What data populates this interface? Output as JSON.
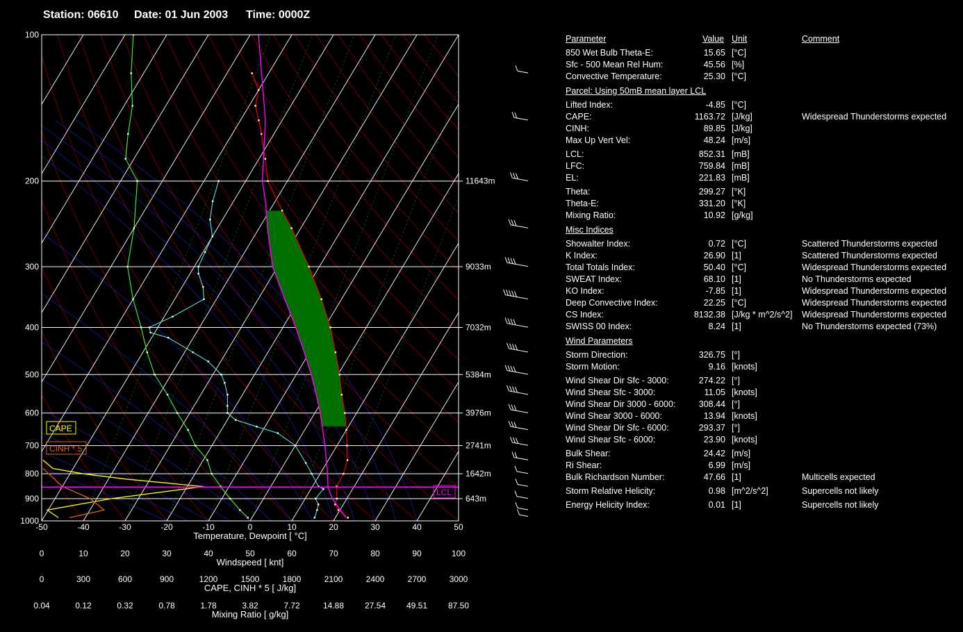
{
  "header": {
    "station": "Station: 06610",
    "date": "Date: 01 Jun 2003",
    "time": "Time: 0000Z"
  },
  "colors": {
    "background": "#000000",
    "temperature": "#ff0000",
    "dewpoint": "#55e0e0",
    "parcel": "#ff00ff",
    "mixing_ratio": "#33ff33",
    "cape_fill": "#007000",
    "cape_label": "#ffff00",
    "cinh_label": "#d9602a",
    "lcl": "#ff00ff"
  },
  "chart_data": {
    "type": "line",
    "title": "",
    "pressure_ticks": [
      "100",
      "200",
      "300",
      "400",
      "500",
      "600",
      "700",
      "800",
      "900",
      "1000"
    ],
    "pressure_values": [
      100,
      200,
      300,
      400,
      500,
      600,
      700,
      800,
      900,
      1000
    ],
    "height_labels": [
      {
        "p": 200,
        "label": "11643m"
      },
      {
        "p": 300,
        "label": "9033m"
      },
      {
        "p": 400,
        "label": "7032m"
      },
      {
        "p": 500,
        "label": "5384m"
      },
      {
        "p": 600,
        "label": "3976m"
      },
      {
        "p": 700,
        "label": "2741m"
      },
      {
        "p": 800,
        "label": "1642m"
      },
      {
        "p": 900,
        "label": "643m"
      }
    ],
    "axes": [
      {
        "label": "Temperature, Dewpoint  [ °C]",
        "ticks": [
          "-50",
          "-40",
          "-30",
          "-20",
          "-10",
          "0",
          "10",
          "20",
          "30",
          "40",
          "50"
        ]
      },
      {
        "label": "Windspeed  [ knt]",
        "ticks": [
          "0",
          "10",
          "20",
          "30",
          "40",
          "50",
          "60",
          "70",
          "80",
          "90",
          "100"
        ]
      },
      {
        "label": "CAPE, CINH * 5  [ J/kg]",
        "ticks": [
          "0",
          "300",
          "600",
          "900",
          "1200",
          "1500",
          "1800",
          "2100",
          "2400",
          "2700",
          "3000"
        ]
      },
      {
        "label": "Mixing Ratio  [ g/kg]",
        "ticks": [
          "0.04",
          "0.12",
          "0.32",
          "0.78",
          "1.78",
          "3.82",
          "7.72",
          "14.88",
          "27.54",
          "49.51",
          "87.50"
        ]
      }
    ],
    "xlim": [
      -50,
      50
    ],
    "ylim": [
      100,
      1000
    ],
    "labels": {
      "cape": "CAPE",
      "cinh": "CINH * 5",
      "lcl": "LCL"
    },
    "series": [
      {
        "key": "temperature",
        "points": [
          [
            985,
            23
          ],
          [
            950,
            19.6
          ],
          [
            925,
            18
          ],
          [
            900,
            17.6
          ],
          [
            850,
            15.8
          ],
          [
            800,
            15.6
          ],
          [
            750,
            14.6
          ],
          [
            700,
            12.4
          ],
          [
            650,
            10
          ],
          [
            600,
            7.2
          ],
          [
            550,
            3.8
          ],
          [
            500,
            0.4
          ],
          [
            450,
            -3.8
          ],
          [
            400,
            -8.6
          ],
          [
            350,
            -14.8
          ],
          [
            300,
            -22.5
          ],
          [
            250,
            -32.2
          ],
          [
            230,
            -37
          ],
          [
            200,
            -44.7
          ],
          [
            180,
            -48.5
          ],
          [
            160,
            -53
          ],
          [
            150,
            -55.6
          ],
          [
            140,
            -58.5
          ],
          [
            130,
            -60
          ],
          [
            120,
            -64
          ]
        ]
      },
      {
        "key": "dewpoint",
        "points": [
          [
            985,
            15
          ],
          [
            950,
            14.5
          ],
          [
            925,
            14
          ],
          [
            900,
            12.5
          ],
          [
            860,
            13
          ],
          [
            850,
            11.5
          ],
          [
            800,
            8
          ],
          [
            760,
            5
          ],
          [
            700,
            0
          ],
          [
            660,
            -6
          ],
          [
            640,
            -12
          ],
          [
            620,
            -18
          ],
          [
            600,
            -21
          ],
          [
            580,
            -22
          ],
          [
            550,
            -23.6
          ],
          [
            520,
            -26
          ],
          [
            500,
            -28
          ],
          [
            470,
            -33
          ],
          [
            450,
            -38
          ],
          [
            420,
            -46
          ],
          [
            410,
            -51
          ],
          [
            400,
            -52
          ],
          [
            380,
            -48
          ],
          [
            350,
            -43
          ],
          [
            330,
            -45
          ],
          [
            310,
            -48
          ],
          [
            300,
            -49
          ],
          [
            280,
            -49.5
          ],
          [
            260,
            -50
          ],
          [
            240,
            -53
          ],
          [
            220,
            -55
          ],
          [
            200,
            -56.5
          ]
        ]
      },
      {
        "key": "parcel",
        "points": [
          [
            985,
            22.5
          ],
          [
            900,
            16.5
          ],
          [
            852,
            13.8
          ],
          [
            800,
            11.8
          ],
          [
            750,
            9.5
          ],
          [
            700,
            7.1
          ],
          [
            650,
            4.3
          ],
          [
            600,
            1.3
          ],
          [
            550,
            -2.3
          ],
          [
            500,
            -6.4
          ],
          [
            450,
            -11.3
          ],
          [
            400,
            -16.9
          ],
          [
            350,
            -23.6
          ],
          [
            300,
            -31.2
          ],
          [
            250,
            -38
          ],
          [
            222,
            -42
          ],
          [
            200,
            -46
          ],
          [
            150,
            -54
          ],
          [
            100,
            -68
          ]
        ]
      },
      {
        "key": "mixing_ratio",
        "points": [
          [
            985,
            -1
          ],
          [
            950,
            -4
          ],
          [
            900,
            -8
          ],
          [
            850,
            -12
          ],
          [
            800,
            -16
          ],
          [
            750,
            -19
          ],
          [
            700,
            -24
          ],
          [
            650,
            -28
          ],
          [
            600,
            -33
          ],
          [
            550,
            -38
          ],
          [
            500,
            -44
          ],
          [
            450,
            -49
          ],
          [
            400,
            -54
          ],
          [
            350,
            -60
          ],
          [
            300,
            -66
          ],
          [
            250,
            -70
          ],
          [
            200,
            -76
          ],
          [
            180,
            -82
          ],
          [
            160,
            -85
          ],
          [
            140,
            -88
          ],
          [
            120,
            -93
          ],
          [
            100,
            -98
          ]
        ]
      }
    ],
    "cape_profile": [
      [
        985,
        120
      ],
      [
        950,
        40
      ],
      [
        900,
        500
      ],
      [
        850,
        1163.72
      ],
      [
        820,
        600
      ],
      [
        800,
        300
      ],
      [
        780,
        80
      ],
      [
        750,
        10
      ]
    ],
    "cinh_profile": [
      [
        985,
        200
      ],
      [
        950,
        449.25
      ],
      [
        900,
        350
      ],
      [
        850,
        150
      ],
      [
        800,
        50
      ],
      [
        780,
        10
      ]
    ],
    "wind_profile": [
      {
        "p": 980,
        "speed": 5
      },
      {
        "p": 950,
        "speed": 10
      },
      {
        "p": 900,
        "speed": 12
      },
      {
        "p": 850,
        "speed": 10
      },
      {
        "p": 800,
        "speed": 12
      },
      {
        "p": 750,
        "speed": 20
      },
      {
        "p": 700,
        "speed": 25
      },
      {
        "p": 650,
        "speed": 30
      },
      {
        "p": 600,
        "speed": 30
      },
      {
        "p": 550,
        "speed": 35
      },
      {
        "p": 500,
        "speed": 40
      },
      {
        "p": 450,
        "speed": 35
      },
      {
        "p": 400,
        "speed": 40
      },
      {
        "p": 350,
        "speed": 45
      },
      {
        "p": 300,
        "speed": 40
      },
      {
        "p": 250,
        "speed": 30
      },
      {
        "p": 200,
        "speed": 25
      },
      {
        "p": 150,
        "speed": 20
      },
      {
        "p": 120,
        "speed": 10
      }
    ]
  },
  "indices": {
    "headers": {
      "parameter": "Parameter",
      "value": "Value",
      "unit": "Unit",
      "comment": "Comment"
    },
    "basic": [
      {
        "p": "850 Wet Bulb Theta-E:",
        "v": "15.65",
        "u": "[°C]",
        "c": ""
      },
      {
        "p": "Sfc - 500 Mean Rel Hum:",
        "v": "45.56",
        "u": "[%]",
        "c": ""
      },
      {
        "p": "Convective Temperature:",
        "v": "25.30",
        "u": "[°C]",
        "c": ""
      }
    ],
    "parcel_title": "Parcel: Using 50mB mean layer LCL",
    "parcel_a": [
      {
        "p": "Lifted Index:",
        "v": "-4.85",
        "u": "[°C]",
        "c": ""
      },
      {
        "p": "CAPE:",
        "v": "1163.72",
        "u": "[J/kg]",
        "c": "Widespread Thunderstorms expected"
      },
      {
        "p": "CINH:",
        "v": "89.85",
        "u": "[J/kg]",
        "c": ""
      },
      {
        "p": "Max Up Vert Vel:",
        "v": "48.24",
        "u": "[m/s]",
        "c": ""
      }
    ],
    "parcel_b": [
      {
        "p": "LCL:",
        "v": "852.31",
        "u": "[mB]",
        "c": ""
      },
      {
        "p": "LFC:",
        "v": "759.84",
        "u": "[mB]",
        "c": ""
      },
      {
        "p": "EL:",
        "v": "221.83",
        "u": "[mB]",
        "c": ""
      }
    ],
    "parcel_c": [
      {
        "p": "Theta:",
        "v": "299.27",
        "u": "[°K]",
        "c": ""
      },
      {
        "p": "Theta-E:",
        "v": "331.20",
        "u": "[°K]",
        "c": ""
      },
      {
        "p": "Mixing Ratio:",
        "v": "10.92",
        "u": "[g/kg]",
        "c": ""
      }
    ],
    "misc_title": "Misc Indices",
    "misc": [
      {
        "p": "Showalter Index:",
        "v": "0.72",
        "u": "[°C]",
        "c": "Scattered Thunderstorms expected"
      },
      {
        "p": "K Index:",
        "v": "26.90",
        "u": "[1]",
        "c": "Scattered Thunderstorms expected"
      },
      {
        "p": "Total Totals Index:",
        "v": "50.40",
        "u": "[°C]",
        "c": "Widespread Thunderstorms expected"
      },
      {
        "p": "SWEAT Index:",
        "v": "68.10",
        "u": "[1]",
        "c": "No Thunderstorms expected"
      },
      {
        "p": "KO Index:",
        "v": "-7.85",
        "u": "[1]",
        "c": "Widespread Thunderstorms expected"
      },
      {
        "p": "Deep Convective Index:",
        "v": "22.25",
        "u": "[°C]",
        "c": "Widespread Thunderstorms expected"
      },
      {
        "p": "CS Index:",
        "v": "8132.38",
        "u": "[J/kg * m^2/s^2]",
        "c": "Widespread Thunderstorms expected"
      },
      {
        "p": "SWISS 00 Index:",
        "v": "8.24",
        "u": "[1]",
        "c": "No Thunderstorms expected (73%)"
      }
    ],
    "wind_title": "Wind Parameters",
    "wind_a": [
      {
        "p": "Storm Direction:",
        "v": "326.75",
        "u": "[°]",
        "c": ""
      },
      {
        "p": "Storm Motion:",
        "v": "9.16",
        "u": "[knots]",
        "c": ""
      }
    ],
    "wind_b": [
      {
        "p": "Wind Shear Dir Sfc - 3000:",
        "v": "274.22",
        "u": "[°]",
        "c": ""
      },
      {
        "p": "Wind Shear Sfc - 3000:",
        "v": "11.05",
        "u": "[knots]",
        "c": ""
      },
      {
        "p": "Wind Shear Dir 3000 - 6000:",
        "v": "308.44",
        "u": "[°]",
        "c": ""
      },
      {
        "p": "Wind Shear 3000 - 6000:",
        "v": "13.94",
        "u": "[knots]",
        "c": ""
      },
      {
        "p": "Wind Shear Dir Sfc - 6000:",
        "v": "293.37",
        "u": "[°]",
        "c": ""
      },
      {
        "p": "Wind Shear Sfc - 6000:",
        "v": "23.90",
        "u": "[knots]",
        "c": ""
      }
    ],
    "wind_c": [
      {
        "p": "Bulk Shear:",
        "v": "24.42",
        "u": "[m/s]",
        "c": ""
      },
      {
        "p": "Ri Shear:",
        "v": "6.99",
        "u": "[m/s]",
        "c": ""
      },
      {
        "p": "Bulk Richardson Number:",
        "v": "47.66",
        "u": "[1]",
        "c": "Multicells expected"
      }
    ],
    "wind_d": [
      {
        "p": "Storm Relative Helicity:",
        "v": "0.98",
        "u": "[m^2/s^2]",
        "c": "Supercells not likely"
      }
    ],
    "wind_e": [
      {
        "p": "Energy Helicity Index:",
        "v": "0.01",
        "u": "[1]",
        "c": "Supercells not likely"
      }
    ]
  }
}
